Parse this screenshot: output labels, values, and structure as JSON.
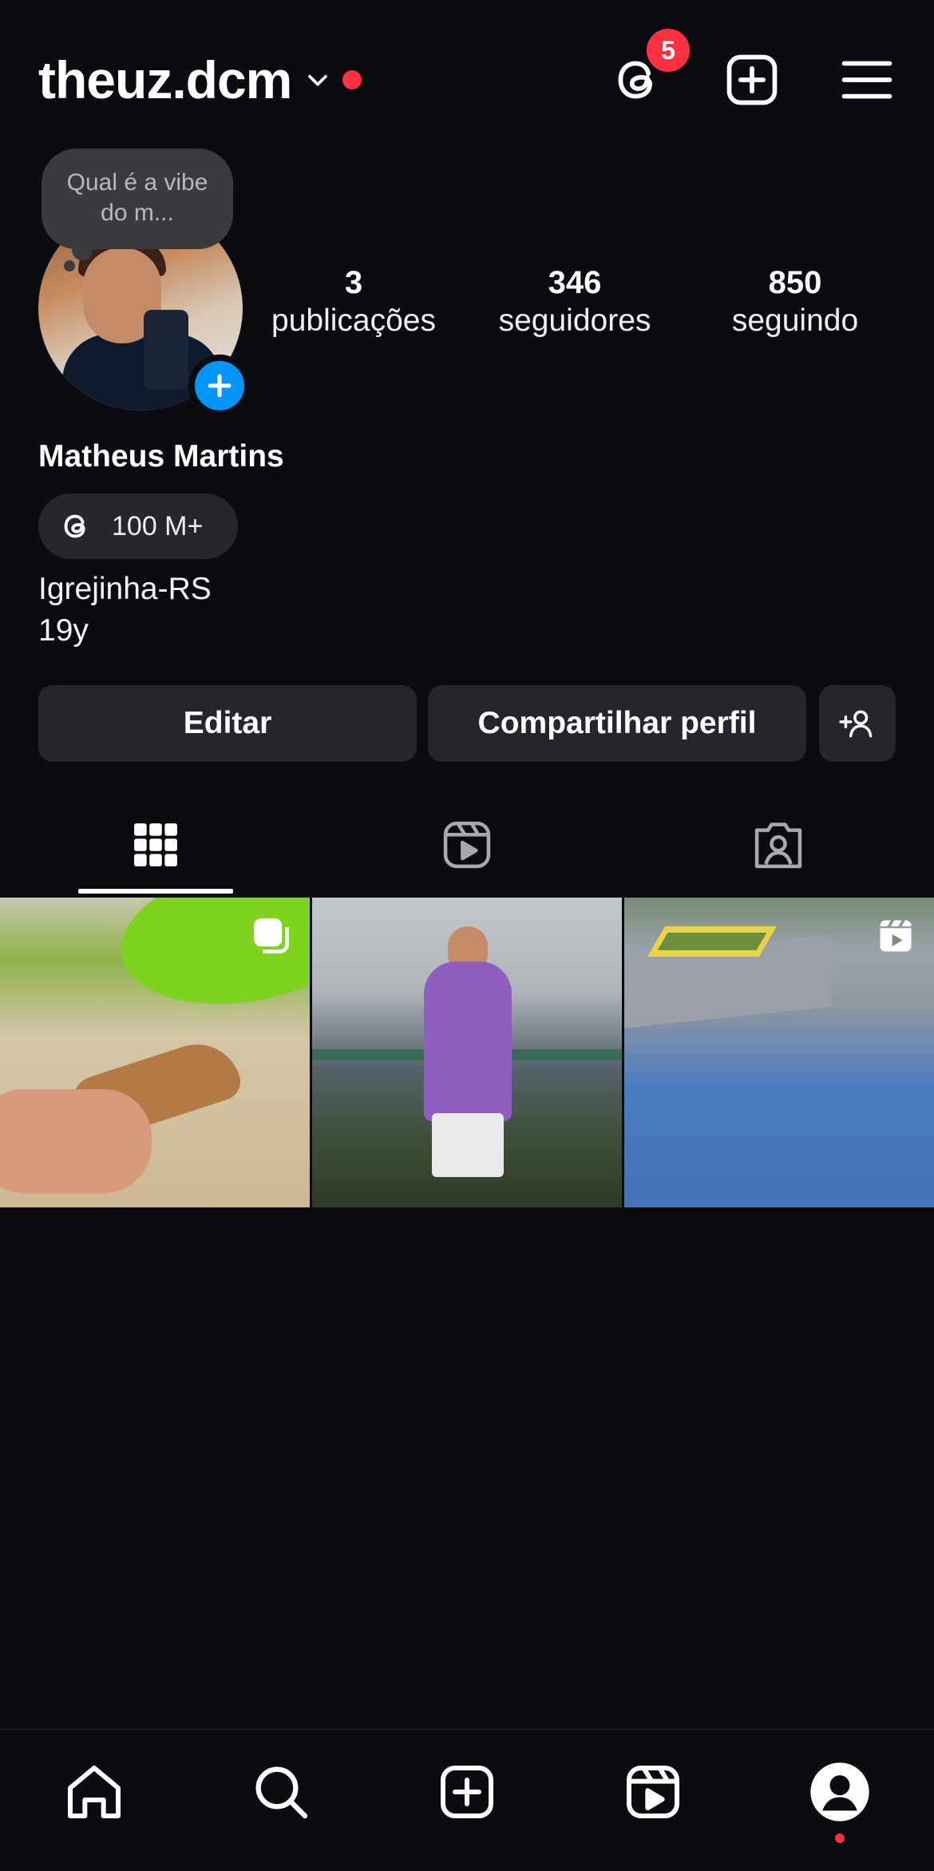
{
  "header": {
    "username": "theuz.dcm",
    "threads_badge": "5"
  },
  "profile": {
    "note_text": "Qual é a vibe do m...",
    "full_name": "Matheus Martins",
    "threads_pill_label": "100 M+",
    "bio_lines": [
      "Igrejinha-RS",
      "19y"
    ],
    "stats": [
      {
        "value": "3",
        "label": "publicações"
      },
      {
        "value": "346",
        "label": "seguidores"
      },
      {
        "value": "850",
        "label": "seguindo"
      }
    ]
  },
  "actions": {
    "edit_label": "Editar",
    "share_label": "Compartilhar perfil"
  },
  "tabs": {
    "selected": "grid",
    "items": [
      "grid-icon",
      "reels-icon",
      "tagged-icon"
    ]
  },
  "grid": {
    "items": [
      {
        "overlay_icon": "carousel-icon"
      },
      {
        "overlay_icon": ""
      },
      {
        "overlay_icon": "reel-icon"
      }
    ]
  },
  "nav": {
    "items": [
      "home-icon",
      "search-icon",
      "create-icon",
      "reels-icon",
      "profile-icon"
    ],
    "selected": "profile"
  },
  "colors": {
    "background": "#0b0c11",
    "accent_blue": "#0095f6",
    "notification_red": "#ff3040",
    "button_bg": "#25262b"
  }
}
